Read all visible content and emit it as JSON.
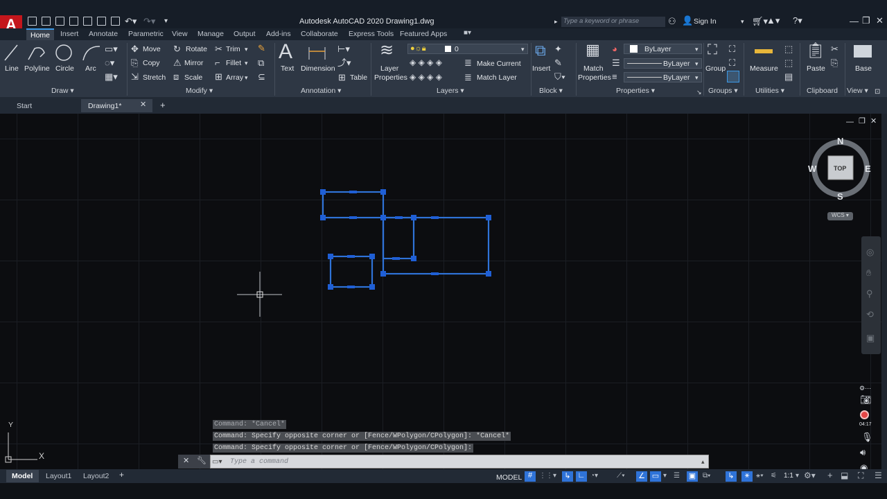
{
  "window": {
    "title": "Autodesk AutoCAD 2020    Drawing1.dwg",
    "search_placeholder": "Type a keyword or phrase",
    "sign_in": "Sign In",
    "logo": "A"
  },
  "ribbon_tabs": [
    "Home",
    "Insert",
    "Annotate",
    "Parametric",
    "View",
    "Manage",
    "Output",
    "Add-ins",
    "Collaborate",
    "Express Tools",
    "Featured Apps"
  ],
  "panels": {
    "draw": {
      "label": "Draw ▾",
      "tools": [
        "Line",
        "Polyline",
        "Circle",
        "Arc"
      ]
    },
    "modify": {
      "label": "Modify ▾",
      "tools": [
        "Move",
        "Rotate",
        "Trim",
        "Copy",
        "Mirror",
        "Fillet",
        "Stretch",
        "Scale",
        "Array"
      ]
    },
    "annotation": {
      "label": "Annotation ▾",
      "text": "Text",
      "dimension": "Dimension",
      "table": "Table"
    },
    "layers": {
      "label": "Layers ▾",
      "layer_props_1": "Layer",
      "layer_props_2": "Properties",
      "current_layer": "0",
      "make_current": "Make Current",
      "match_layer": "Match Layer"
    },
    "block": {
      "label": "Block ▾",
      "insert": "Insert"
    },
    "properties": {
      "label": "Properties ▾",
      "match_1": "Match",
      "match_2": "Properties",
      "color": "ByLayer",
      "linetype": "ByLayer",
      "lineweight": "ByLayer"
    },
    "groups": {
      "label": "Groups ▾",
      "group": "Group"
    },
    "utilities": {
      "label": "Utilities ▾",
      "measure": "Measure"
    },
    "clipboard": {
      "label": "Clipboard",
      "paste": "Paste"
    },
    "view": {
      "label": "View ▾",
      "base": "Base"
    }
  },
  "doc_tabs": {
    "start": "Start",
    "drawing": "Drawing1*"
  },
  "viewcube": {
    "n": "N",
    "s": "S",
    "e": "E",
    "w": "W",
    "top": "TOP",
    "wcs": "WCS ▾"
  },
  "ucs": {
    "x": "X",
    "y": "Y"
  },
  "command_history": [
    "Command: *Cancel*",
    "Command: Specify opposite corner or [Fence/WPolygon/CPolygon]: *Cancel*",
    "Command: Specify opposite corner or [Fence/WPolygon/CPolygon]:"
  ],
  "command_placeholder": "Type a command",
  "layout_tabs": [
    "Model",
    "Layout1",
    "Layout2"
  ],
  "status": {
    "model": "MODEL",
    "scale": "1:1"
  },
  "recorder_time": "04:17",
  "colors": {
    "selection": "#2f73d8",
    "grip": "#1f5fd6",
    "accent": "#3c9ae8",
    "logo": "#c4161c"
  }
}
